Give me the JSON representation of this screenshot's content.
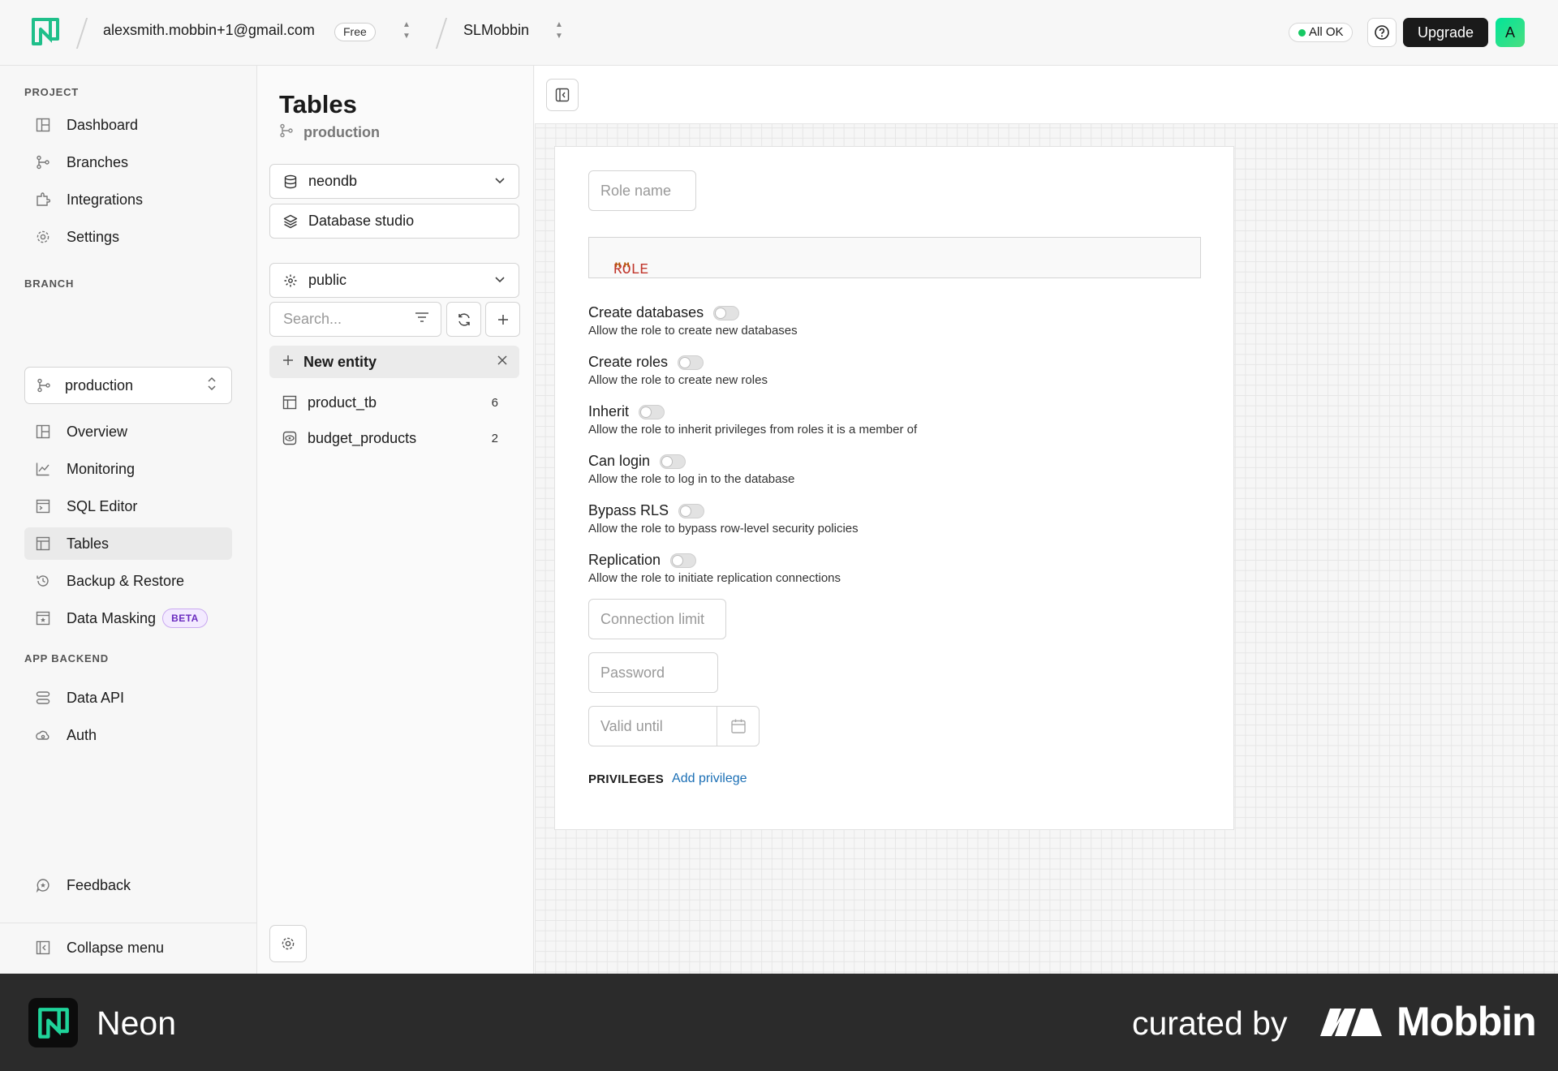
{
  "topbar": {
    "account_email": "alexsmith.mobbin+1@gmail.com",
    "plan_badge": "Free",
    "project_name": "SLMobbin",
    "status": "All OK",
    "upgrade_label": "Upgrade",
    "avatar_initial": "A"
  },
  "sidebar": {
    "project_label": "PROJECT",
    "project_items": [
      {
        "label": "Dashboard",
        "icon": "dashboard-icon"
      },
      {
        "label": "Branches",
        "icon": "branches-icon"
      },
      {
        "label": "Integrations",
        "icon": "integrations-icon"
      },
      {
        "label": "Settings",
        "icon": "gear-icon"
      }
    ],
    "branch_label": "BRANCH",
    "branch_selected": "production",
    "branch_items": [
      {
        "label": "Overview",
        "icon": "overview-icon"
      },
      {
        "label": "Monitoring",
        "icon": "monitoring-icon"
      },
      {
        "label": "SQL Editor",
        "icon": "sql-editor-icon"
      },
      {
        "label": "Tables",
        "icon": "table-icon",
        "active": true
      },
      {
        "label": "Backup & Restore",
        "icon": "history-icon"
      },
      {
        "label": "Data Masking",
        "icon": "data-masking-icon",
        "badge": "BETA"
      }
    ],
    "app_backend_label": "APP BACKEND",
    "app_backend_items": [
      {
        "label": "Data API",
        "icon": "data-api-icon"
      },
      {
        "label": "Auth",
        "icon": "auth-icon"
      }
    ],
    "feedback_label": "Feedback",
    "collapse_label": "Collapse menu"
  },
  "tables_panel": {
    "title": "Tables",
    "branch": "production",
    "database": "neondb",
    "studio_label": "Database studio",
    "schema": "public",
    "search_placeholder": "Search...",
    "new_entity_label": "New entity",
    "tables": [
      {
        "name": "product_tb",
        "count": "6",
        "icon": "table-icon"
      },
      {
        "name": "budget_products",
        "count": "2",
        "icon": "view-icon"
      }
    ]
  },
  "role_form": {
    "role_name_placeholder": "Role name",
    "code_keyword": "ROLE",
    "code_value": "\"\"",
    "options": [
      {
        "title": "Create databases",
        "desc": "Allow the role to create new databases",
        "on": false
      },
      {
        "title": "Create roles",
        "desc": "Allow the role to create new roles",
        "on": false
      },
      {
        "title": "Inherit",
        "desc": "Allow the role to inherit privileges from roles it is a member of",
        "on": false
      },
      {
        "title": "Can login",
        "desc": "Allow the role to log in to the database",
        "on": false
      },
      {
        "title": "Bypass RLS",
        "desc": "Allow the role to bypass row-level security policies",
        "on": false
      },
      {
        "title": "Replication",
        "desc": "Allow the role to initiate replication connections",
        "on": false
      }
    ],
    "connection_limit_placeholder": "Connection limit",
    "password_placeholder": "Password",
    "valid_until_placeholder": "Valid until",
    "privileges_label": "PRIVILEGES",
    "add_privilege_label": "Add privilege"
  },
  "footer": {
    "app_name": "Neon",
    "curated_by": "curated by",
    "brand": "Mobbin"
  },
  "colors": {
    "accent": "#00e599",
    "link": "#1b6fb5",
    "beta_badge": "#6a2bbf"
  }
}
